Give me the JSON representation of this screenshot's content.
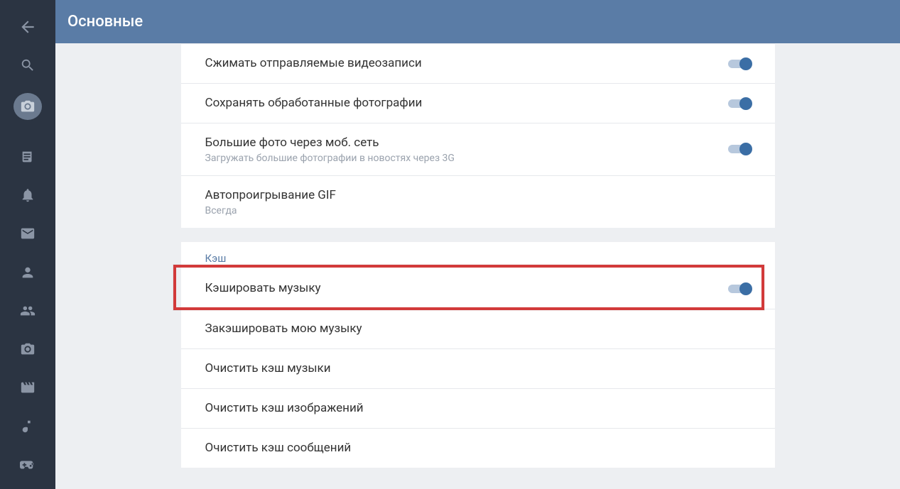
{
  "header": {
    "title": "Основные"
  },
  "section1": {
    "rows": [
      {
        "title": "Сжимать отправляемые видеозаписи",
        "sub": null,
        "toggle": true
      },
      {
        "title": "Сохранять обработанные фотографии",
        "sub": null,
        "toggle": true
      },
      {
        "title": "Большие фото через моб. сеть",
        "sub": "Загружать большие фотографии в новостях через 3G",
        "toggle": true
      },
      {
        "title": "Автопроигрывание GIF",
        "sub": "Всегда",
        "toggle": false
      }
    ]
  },
  "section2": {
    "header": "Кэш",
    "rows": [
      {
        "title": "Кэшировать музыку",
        "toggle": true,
        "highlight": true
      },
      {
        "title": "Закэшировать мою музыку",
        "toggle": false
      },
      {
        "title": "Очистить кэш музыки",
        "toggle": false
      },
      {
        "title": "Очистить кэш изображений",
        "toggle": false
      },
      {
        "title": "Очистить кэш сообщений",
        "toggle": false
      }
    ]
  }
}
